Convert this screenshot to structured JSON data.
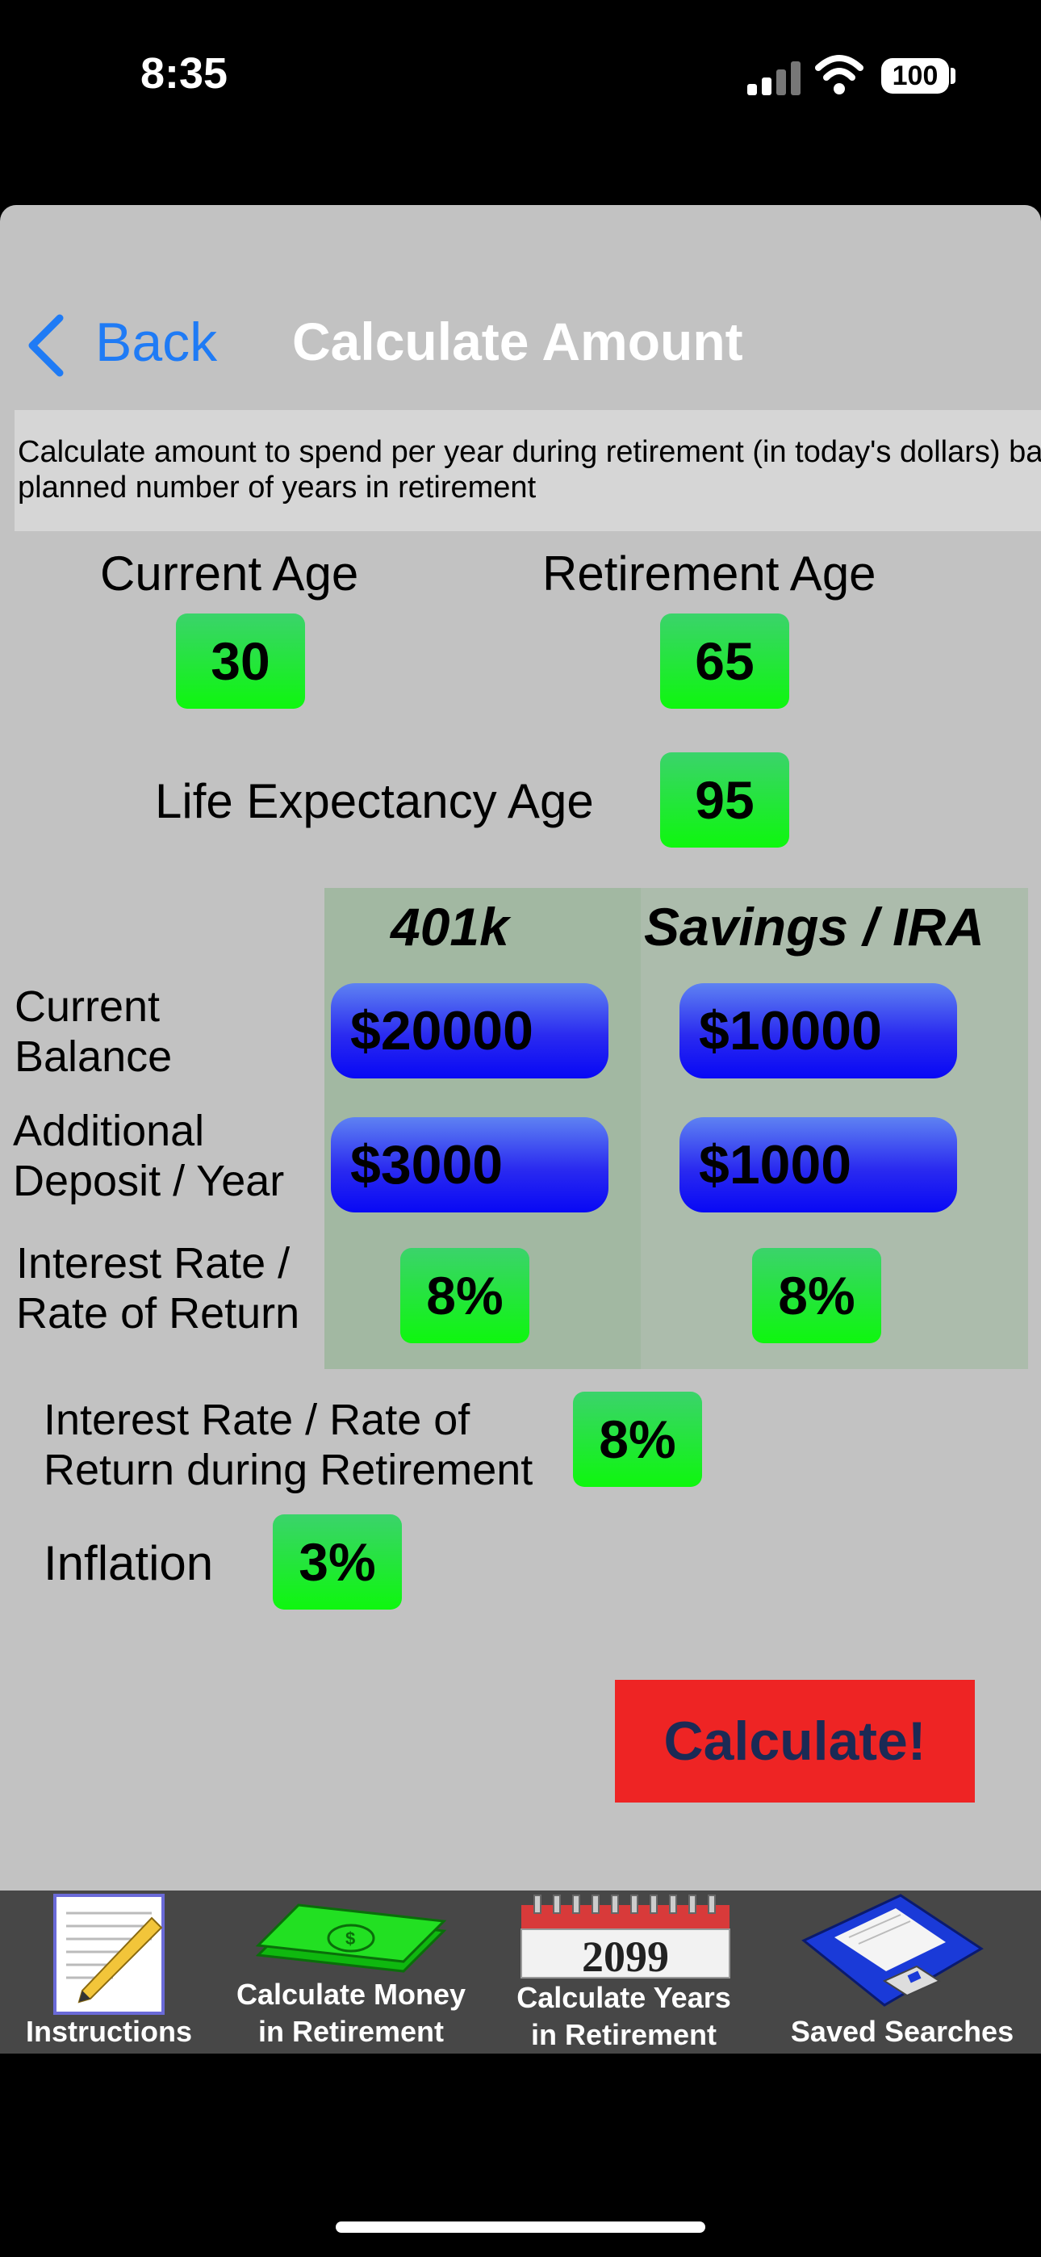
{
  "status_bar": {
    "time": "8:35",
    "battery": "100"
  },
  "nav": {
    "back_label": "Back",
    "title": "Calculate Amount"
  },
  "description": "Calculate amount to spend per year during retirement (in today's dollars) based on planned number of years in retirement",
  "ages": {
    "current_age_label": "Current Age",
    "current_age_value": "30",
    "retirement_age_label": "Retirement Age",
    "retirement_age_value": "65",
    "life_expectancy_label": "Life Expectancy Age",
    "life_expectancy_value": "95"
  },
  "accounts": {
    "col_401k": "401k",
    "col_savings": "Savings / IRA",
    "row_balance_label_1": "Current",
    "row_balance_label_2": "Balance",
    "row_deposit_label_1": "Additional",
    "row_deposit_label_2": "Deposit / Year",
    "row_rate_label_1": "Interest Rate /",
    "row_rate_label_2": "Rate of Return",
    "balance_401k": "$20000",
    "balance_savings": "$10000",
    "deposit_401k": "$3000",
    "deposit_savings": "$1000",
    "rate_401k": "8%",
    "rate_savings": "8%"
  },
  "retirement": {
    "rate_label_1": "Interest Rate / Rate of",
    "rate_label_2": "Return during Retirement",
    "rate_value": "8%",
    "inflation_label": "Inflation",
    "inflation_value": "3%"
  },
  "calculate_label": "Calculate!",
  "tabs": [
    {
      "label_1": "Instructions",
      "label_2": "",
      "icon": "notepad-pencil-icon"
    },
    {
      "label_1": "Calculate Money",
      "label_2": "in Retirement",
      "icon": "money-stack-icon"
    },
    {
      "label_1": "Calculate Years",
      "label_2": "in Retirement",
      "icon": "calendar-icon",
      "icon_text": "2099"
    },
    {
      "label_1": "Saved Searches",
      "label_2": "",
      "icon": "floppy-disk-icon"
    }
  ],
  "colors": {
    "accent_blue": "#1f7bf5",
    "calc_red": "#ee2424",
    "value_green": "#0ef70e"
  }
}
